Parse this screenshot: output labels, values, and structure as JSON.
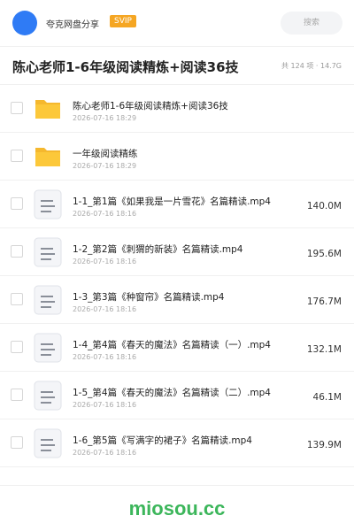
{
  "topbar": {
    "app_name": "夸克网盘分享",
    "badge": "SVIP",
    "search_placeholder": "搜索"
  },
  "header": {
    "title": "陈心老师1-6年级阅读精炼+阅读36技",
    "stats": "共 124 项 · 14.7G"
  },
  "colors": {
    "accent": "#2f7bf5",
    "badge": "#f5a623",
    "folder": "#fcc83a",
    "watermark": "#3cb65b"
  },
  "items": [
    {
      "type": "folder",
      "icon": "folder-icon",
      "name": "陈心老师1-6年级阅读精炼+阅读36技",
      "date": "2026-07-16 18:29",
      "size": ""
    },
    {
      "type": "folder",
      "icon": "folder-icon",
      "name": "一年级阅读精练",
      "date": "2026-07-16 18:29",
      "size": ""
    },
    {
      "type": "file",
      "icon": "document-icon",
      "name": "1-1_第1篇《如果我是一片雪花》名篇精读.mp4",
      "date": "2026-07-16 18:16",
      "size": "140.0M"
    },
    {
      "type": "file",
      "icon": "document-icon",
      "name": "1-2_第2篇《刺猬的新装》名篇精读.mp4",
      "date": "2026-07-16 18:16",
      "size": "195.6M"
    },
    {
      "type": "file",
      "icon": "document-icon",
      "name": "1-3_第3篇《种窗帘》名篇精读.mp4",
      "date": "2026-07-16 18:16",
      "size": "176.7M"
    },
    {
      "type": "file",
      "icon": "document-icon",
      "name": "1-4_第4篇《春天的魔法》名篇精读（一）.mp4",
      "date": "2026-07-16 18:16",
      "size": "132.1M"
    },
    {
      "type": "file",
      "icon": "document-icon",
      "name": "1-5_第4篇《春天的魔法》名篇精读（二）.mp4",
      "date": "2026-07-16 18:16",
      "size": "46.1M"
    },
    {
      "type": "file",
      "icon": "document-icon",
      "name": "1-6_第5篇《写满字的裙子》名篇精读.mp4",
      "date": "2026-07-16 18:16",
      "size": "139.9M"
    }
  ],
  "footer": {
    "watermark": "miosou.cc"
  }
}
